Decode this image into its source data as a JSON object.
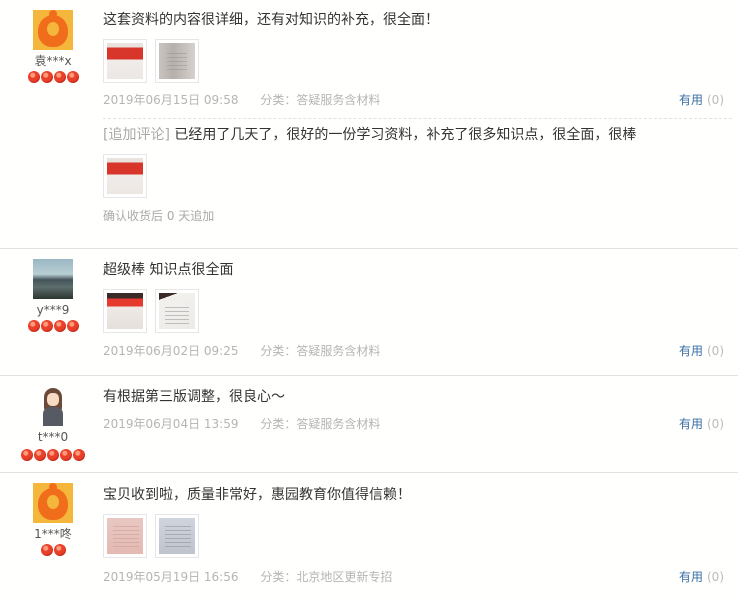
{
  "reviews": [
    {
      "user": "袁***x",
      "text": "这套资料的内容很详细，还有对知识的补充，很全面！",
      "date": "2019年06月15日 09:58",
      "category": "分类：答疑服务含材料",
      "useful_label": "有用",
      "useful_count": "(0)",
      "append": {
        "tag": "[追加评论]",
        "text": " 已经用了几天了，很好的一份学习资料，补充了很多知识点，很全面，很棒",
        "confirm": "确认收货后 0 天追加"
      }
    },
    {
      "user": "y***9",
      "text": "超级棒 知识点很全面",
      "date": "2019年06月02日 09:25",
      "category": "分类：答疑服务含材料",
      "useful_label": "有用",
      "useful_count": "(0)"
    },
    {
      "user": "t***0",
      "text": "有根据第三版调整，很良心～",
      "date": "2019年06月04日 13:59",
      "category": "分类：答疑服务含材料",
      "useful_label": "有用",
      "useful_count": "(0)"
    },
    {
      "user": "1***咚",
      "text": "宝贝收到啦，质量非常好，惠园教育你值得信赖！",
      "date": "2019年05月19日 16:56",
      "category": "分类：北京地区更新专招",
      "useful_label": "有用",
      "useful_count": "(0)"
    }
  ]
}
